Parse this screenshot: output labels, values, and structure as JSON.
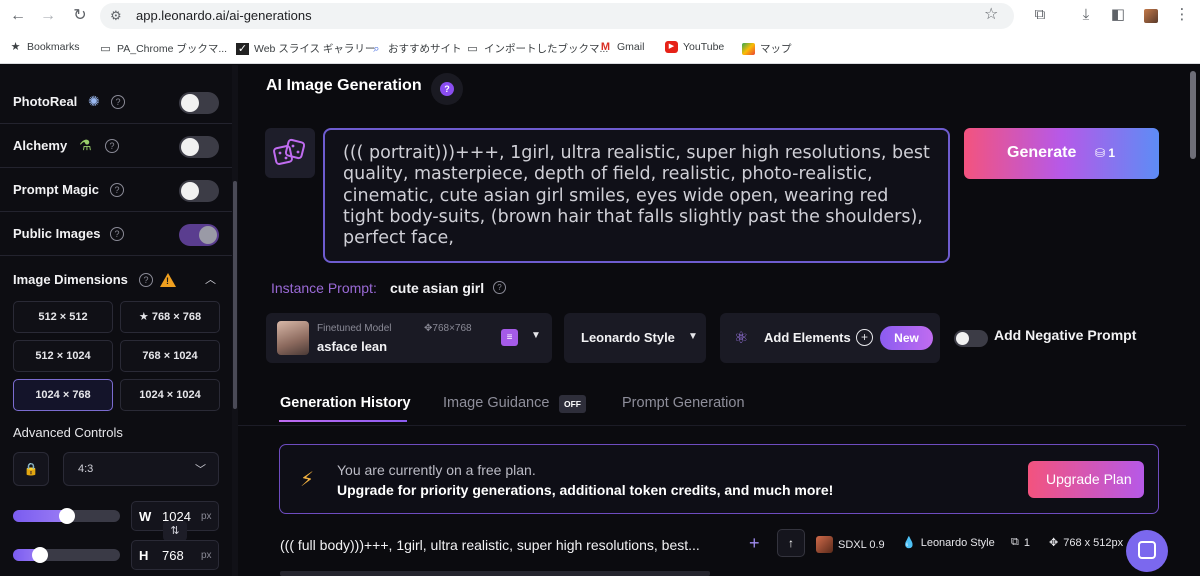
{
  "browser": {
    "url": "app.leonardo.ai/ai-generations",
    "bookmarks": [
      {
        "label": "Bookmarks",
        "icon": "star-icon"
      },
      {
        "label": "PA_Chrome ブックマ...",
        "icon": "folder-icon"
      },
      {
        "label": "Web スライス ギャラリー",
        "icon": "web-slice-icon"
      },
      {
        "label": "おすすめサイト",
        "icon": "search-icon"
      },
      {
        "label": "インポートしたブックマ...",
        "icon": "folder-icon"
      },
      {
        "label": "Gmail",
        "icon": "gmail-icon"
      },
      {
        "label": "YouTube",
        "icon": "youtube-icon"
      },
      {
        "label": "マップ",
        "icon": "maps-icon"
      }
    ]
  },
  "sidebar": {
    "toggles": [
      {
        "label": "PhotoReal",
        "on": false
      },
      {
        "label": "Alchemy",
        "on": false
      },
      {
        "label": "Prompt Magic",
        "on": false
      },
      {
        "label": "Public Images",
        "on": true
      }
    ],
    "dimensions_label": "Image Dimensions",
    "dimension_options": [
      "512 × 512",
      "★ 768 × 768",
      "512 × 1024",
      "768 × 1024",
      "1024 × 768",
      "1024 × 1024"
    ],
    "selected_dimension": "1024 × 768",
    "advanced_label": "Advanced Controls",
    "aspect_ratio": "4:3",
    "width": {
      "key": "W",
      "value": "1024",
      "unit": "px",
      "slider": 0.5
    },
    "height": {
      "key": "H",
      "value": "768",
      "unit": "px",
      "slider": 0.25
    }
  },
  "main": {
    "title": "AI Image Generation",
    "prompt": "((( portrait)))+++, 1girl, ultra realistic, super high resolutions, best quality, masterpiece, depth of field, realistic, photo-realistic, cinematic, cute asian girl smiles, eyes wide open, wearing red tight body-suits, (brown hair that falls slightly past the shoulders), perfect face,",
    "generate_label": "Generate",
    "generate_tokens": "1",
    "instance_prompt_label": "Instance Prompt:",
    "instance_prompt_value": "cute asian girl",
    "model": {
      "caption": "Finetuned Model",
      "size": "768×768",
      "name": "asface lean"
    },
    "style": "Leonardo Style",
    "add_elements": "Add Elements",
    "new_badge": "New",
    "negative_prompt_label": "Add Negative Prompt",
    "tabs": [
      {
        "label": "Generation History",
        "active": true
      },
      {
        "label": "Image Guidance",
        "active": false,
        "badge": "OFF"
      },
      {
        "label": "Prompt Generation",
        "active": false
      }
    ],
    "plan": {
      "line1": "You are currently on a free plan.",
      "line2": "Upgrade for priority generations, additional token credits, and much more!",
      "button": "Upgrade Plan"
    },
    "history": {
      "prompt": "((( full body)))+++, 1girl, ultra realistic, super high resolutions, best...",
      "model": "SDXL 0.9",
      "style": "Leonardo Style",
      "count": "1",
      "size": "768 x 512px"
    }
  }
}
